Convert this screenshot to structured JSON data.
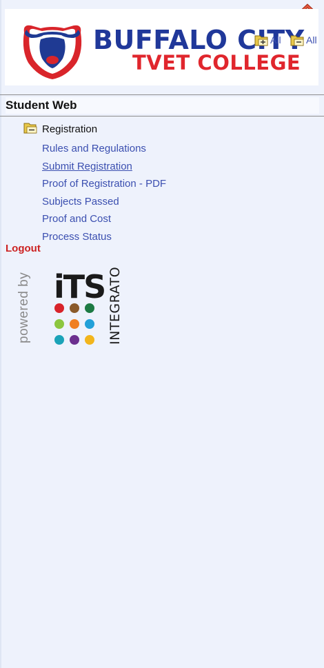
{
  "header": {
    "brand_line1": "BUFFALO CITY",
    "brand_line2": "TVET COLLEGE",
    "expand_all_label": "All",
    "collapse_all_label": "All"
  },
  "section": {
    "title": "Student Web"
  },
  "tree": {
    "root_label": "Registration",
    "items": [
      {
        "label": "Rules and Regulations",
        "active": false
      },
      {
        "label": "Submit Registration",
        "active": true
      },
      {
        "label": "Proof of Registration - PDF",
        "active": false
      },
      {
        "label": "Subjects Passed",
        "active": false
      },
      {
        "label": "Proof and Cost",
        "active": false
      },
      {
        "label": "Process Status",
        "active": false
      }
    ]
  },
  "logout_label": "Logout",
  "footer": {
    "powered_by": "powered by",
    "its_mark": "iTS",
    "integrator": "INTEGRATOR",
    "dot_colors": [
      "#d8232a",
      "#8a5a2b",
      "#1d7a44",
      "#8cc63f",
      "#f07f22",
      "#22a0d8",
      "#1ba3b8",
      "#6b2f8f",
      "#f2b51c"
    ]
  },
  "colors": {
    "brand_blue": "#20389a",
    "brand_red": "#e0262d",
    "link_blue": "#3b4fb0",
    "logout_red": "#cc2222",
    "background": "#eef2fc"
  }
}
